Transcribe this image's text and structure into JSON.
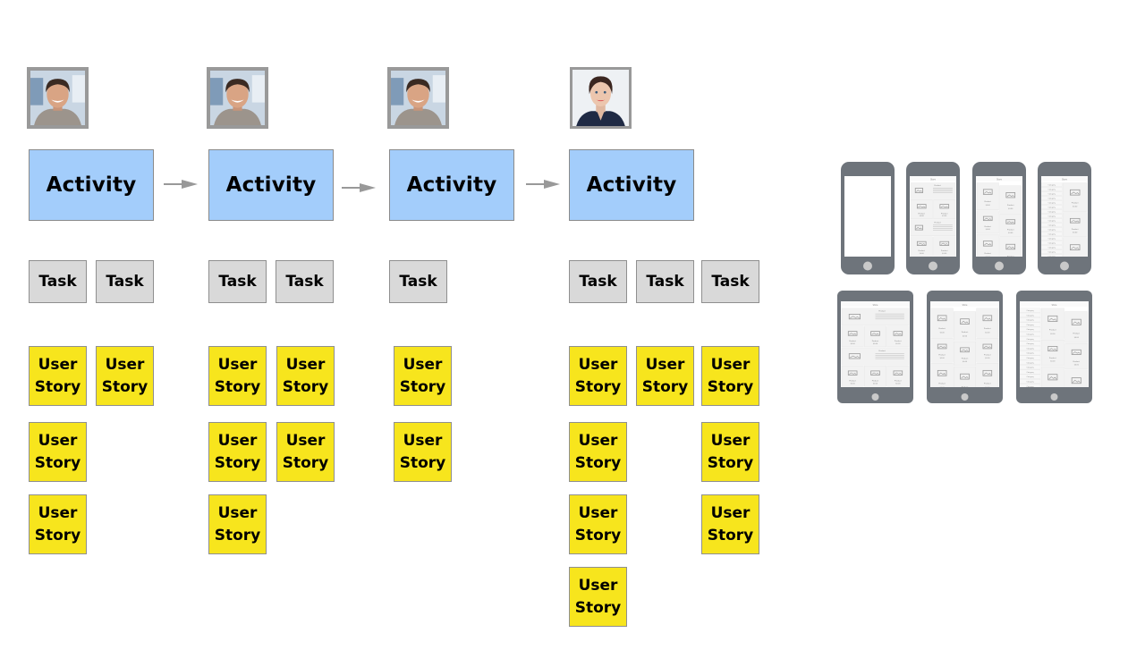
{
  "diagram": {
    "type": "user-story-map",
    "colors": {
      "activity": "#a3cdfb",
      "task": "#d9d9d9",
      "story": "#f7e51d",
      "arrow": "#999999",
      "device": "#6e747b"
    },
    "columns": [
      {
        "persona": "male-user",
        "activity": "Activity",
        "tasks": [
          {
            "label": "Task",
            "stories": [
              {
                "line1": "User",
                "line2": "Story"
              },
              {
                "line1": "User",
                "line2": "Story"
              },
              {
                "line1": "User",
                "line2": "Story"
              }
            ]
          },
          {
            "label": "Task",
            "stories": [
              {
                "line1": "User",
                "line2": "Story"
              }
            ]
          }
        ]
      },
      {
        "persona": "male-user",
        "activity": "Activity",
        "tasks": [
          {
            "label": "Task",
            "stories": [
              {
                "line1": "User",
                "line2": "Story"
              },
              {
                "line1": "User",
                "line2": "Story"
              },
              {
                "line1": "User",
                "line2": "Story"
              }
            ]
          },
          {
            "label": "Task",
            "stories": [
              {
                "line1": "User",
                "line2": "Story"
              },
              {
                "line1": "User",
                "line2": "Story"
              }
            ]
          }
        ]
      },
      {
        "persona": "male-user",
        "activity": "Activity",
        "tasks": [
          {
            "label": "Task",
            "stories": [
              {
                "line1": "User",
                "line2": "Story"
              },
              {
                "line1": "User",
                "line2": "Story"
              }
            ]
          }
        ]
      },
      {
        "persona": "female-user",
        "activity": "Activity",
        "tasks": [
          {
            "label": "Task",
            "stories": [
              {
                "line1": "User",
                "line2": "Story"
              },
              {
                "line1": "User",
                "line2": "Story"
              },
              {
                "line1": "User",
                "line2": "Story"
              },
              {
                "line1": "User",
                "line2": "Story"
              }
            ]
          },
          {
            "label": "Task",
            "stories": [
              {
                "line1": "User",
                "line2": "Story"
              }
            ]
          },
          {
            "label": "Task",
            "stories": [
              {
                "line1": "User",
                "line2": "Story"
              },
              {
                "line1": "User",
                "line2": "Story"
              },
              {
                "line1": "User",
                "line2": "Story"
              }
            ]
          }
        ]
      }
    ]
  },
  "mockups": {
    "phones": [
      {
        "layout": "blank"
      },
      {
        "layout": "list-grid",
        "header": "Store",
        "item": "Product",
        "price": "$0.00"
      },
      {
        "layout": "grid",
        "header": "Store",
        "item": "Product",
        "price": "$0.00"
      },
      {
        "layout": "category-sidebar",
        "header": "Store",
        "item": "Product",
        "price": "$0.00",
        "category": "Category"
      }
    ],
    "tablets": [
      {
        "layout": "list-grid",
        "header": "Store",
        "item": "Product",
        "price": "$0.00"
      },
      {
        "layout": "grid",
        "header": "Store",
        "item": "Product",
        "price": "$0.00"
      },
      {
        "layout": "category-sidebar",
        "header": "Store",
        "item": "Product",
        "price": "$0.00",
        "category": "Category"
      }
    ]
  }
}
